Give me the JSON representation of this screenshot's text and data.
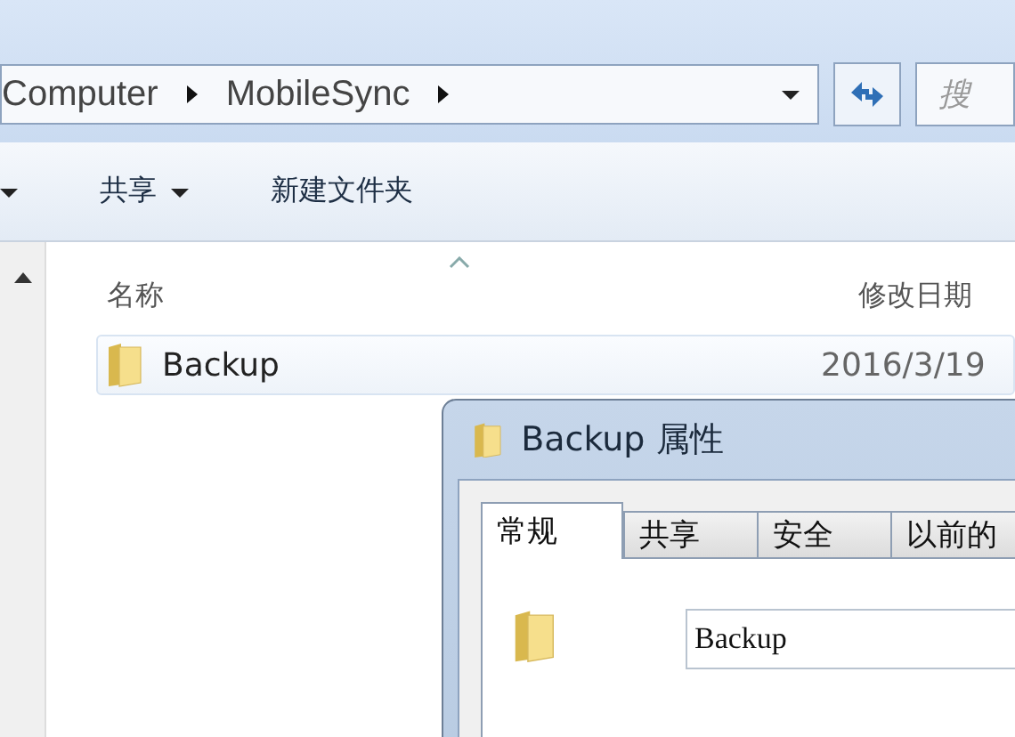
{
  "address_bar": {
    "crumbs": [
      "Computer",
      "MobileSync"
    ]
  },
  "search": {
    "placeholder": "搜"
  },
  "toolbar": {
    "items": [
      {
        "label": "共享",
        "dropdown": true
      },
      {
        "label": "新建文件夹",
        "dropdown": false
      }
    ]
  },
  "file_list": {
    "columns": [
      "名称",
      "修改日期"
    ],
    "rows": [
      {
        "name": "Backup",
        "modified": "2016/3/19",
        "selected": true
      }
    ]
  },
  "dialog": {
    "title": "Backup 属性",
    "tabs": [
      {
        "label": "常规",
        "selected": true
      },
      {
        "label": "共享",
        "selected": false
      },
      {
        "label": "安全",
        "selected": false
      },
      {
        "label": "以前的",
        "selected": false
      }
    ],
    "name_field": {
      "value": "Backup"
    }
  }
}
